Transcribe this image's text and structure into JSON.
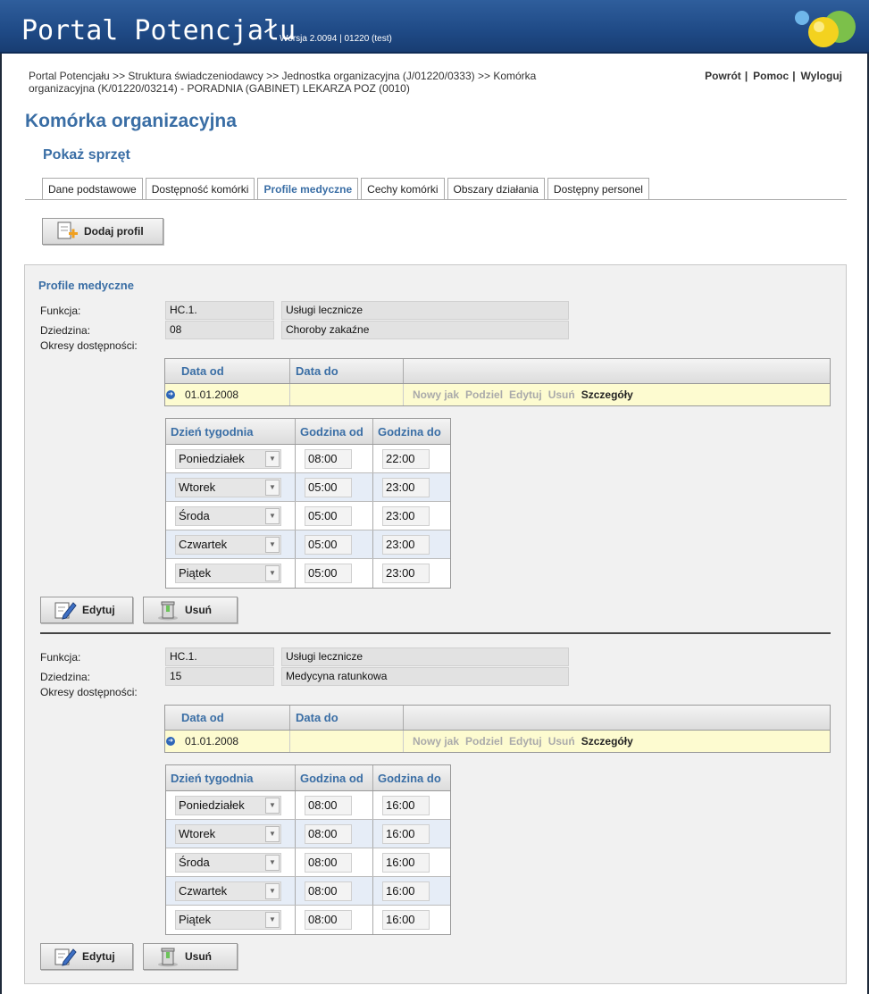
{
  "header": {
    "title": "Portal Potencjału",
    "version": "Wersja 2.0094 | 01220 (test)"
  },
  "breadcrumb": "Portal Potencjału >> Struktura świadczeniodawcy >> Jednostka organizacyjna (J/01220/0333) >> Komórka organizacyjna (K/01220/03214) - PORADNIA (GABINET) LEKARZA POZ (0010)",
  "toplinks": {
    "back": "Powrót",
    "help": "Pomoc",
    "logout": "Wyloguj",
    "sep": "|"
  },
  "page_title": "Komórka organizacyjna",
  "sub_title": "Pokaż sprzęt",
  "tabs": [
    {
      "label": "Dane podstawowe"
    },
    {
      "label": "Dostępność komórki"
    },
    {
      "label": "Profile medyczne"
    },
    {
      "label": "Cechy komórki"
    },
    {
      "label": "Obszary działania"
    },
    {
      "label": "Dostępny personel"
    }
  ],
  "add_profile_label": "Dodaj profil",
  "panel_title": "Profile medyczne",
  "labels": {
    "function": "Funkcja:",
    "field": "Dziedzina:",
    "periods": "Okresy dostępności:"
  },
  "period_headers": {
    "from": "Data od",
    "to": "Data do"
  },
  "day_headers": {
    "day": "Dzień tygodnia",
    "from": "Godzina od",
    "to": "Godzina do"
  },
  "period_actions": {
    "new": "Nowy jak",
    "split": "Podziel",
    "edit": "Edytuj",
    "delete": "Usuń",
    "details": "Szczegóły"
  },
  "buttons": {
    "edit": "Edytuj",
    "delete": "Usuń"
  },
  "profiles": [
    {
      "function_code": "HC.1.",
      "function_name": "Usługi lecznicze",
      "field_code": "08",
      "field_name": "Choroby zakaźne",
      "period_from": "01.01.2008",
      "period_to": "",
      "days": [
        {
          "day": "Poniedziałek",
          "from": "08:00",
          "to": "22:00"
        },
        {
          "day": "Wtorek",
          "from": "05:00",
          "to": "23:00"
        },
        {
          "day": "Środa",
          "from": "05:00",
          "to": "23:00"
        },
        {
          "day": "Czwartek",
          "from": "05:00",
          "to": "23:00"
        },
        {
          "day": "Piątek",
          "from": "05:00",
          "to": "23:00"
        }
      ]
    },
    {
      "function_code": "HC.1.",
      "function_name": "Usługi lecznicze",
      "field_code": "15",
      "field_name": "Medycyna ratunkowa",
      "period_from": "01.01.2008",
      "period_to": "",
      "days": [
        {
          "day": "Poniedziałek",
          "from": "08:00",
          "to": "16:00"
        },
        {
          "day": "Wtorek",
          "from": "08:00",
          "to": "16:00"
        },
        {
          "day": "Środa",
          "from": "08:00",
          "to": "16:00"
        },
        {
          "day": "Czwartek",
          "from": "08:00",
          "to": "16:00"
        },
        {
          "day": "Piątek",
          "from": "08:00",
          "to": "16:00"
        }
      ]
    }
  ]
}
